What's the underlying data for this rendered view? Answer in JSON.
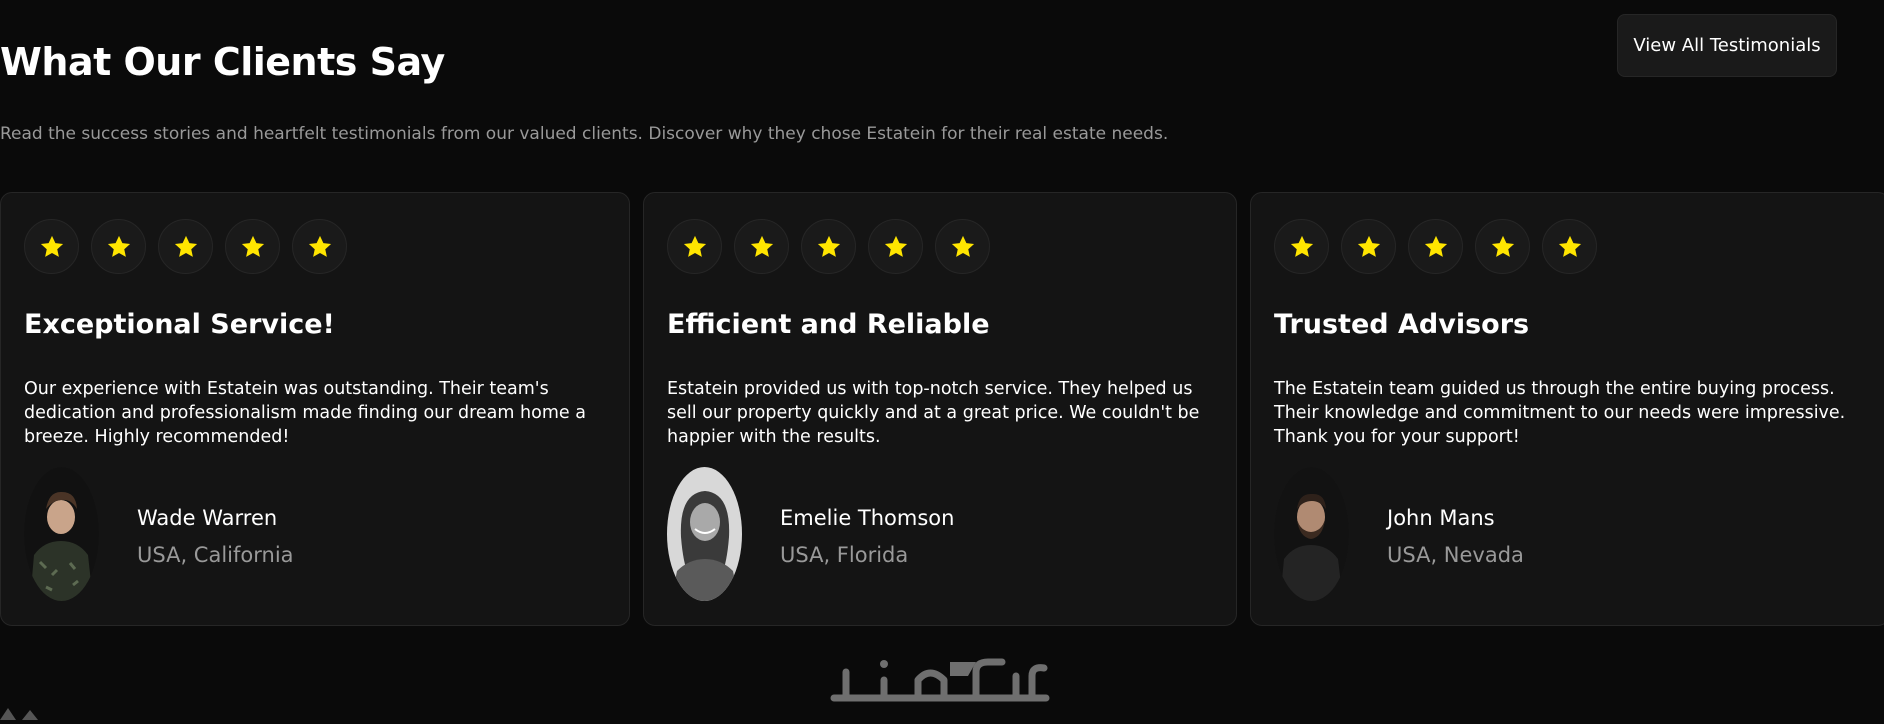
{
  "header": {
    "title": "What Our Clients Say",
    "subtitle": "Read the success stories and heartfelt testimonials from our valued clients. Discover why they chose Estatein for their real estate needs.",
    "view_all_label": "View All Testimonials"
  },
  "testimonials": [
    {
      "rating": 5,
      "title": "Exceptional Service!",
      "text": "Our experience with Estatein was outstanding. Their team's dedication and professionalism made finding our dream home a breeze. Highly recommended!",
      "name": "Wade Warren",
      "location": "USA, California"
    },
    {
      "rating": 5,
      "title": "Efficient and Reliable",
      "text": "Estatein provided us with top-notch service. They helped us sell our property quickly and at a great price. We couldn't be happier with the results.",
      "name": "Emelie Thomson",
      "location": "USA, Florida"
    },
    {
      "rating": 5,
      "title": "Trusted Advisors",
      "text": "The Estatein team guided us through the entire buying process. Their knowledge and commitment to our needs were impressive. Thank you for your support!",
      "name": "John Mans",
      "location": "USA, Nevada"
    }
  ],
  "watermark": {
    "text": "خمسات"
  },
  "colors": {
    "background": "#0a0a0a",
    "card": "#141414",
    "border": "#262626",
    "star": "#ffe500",
    "muted_text": "#999999"
  },
  "icons": {
    "star": "star-icon"
  }
}
